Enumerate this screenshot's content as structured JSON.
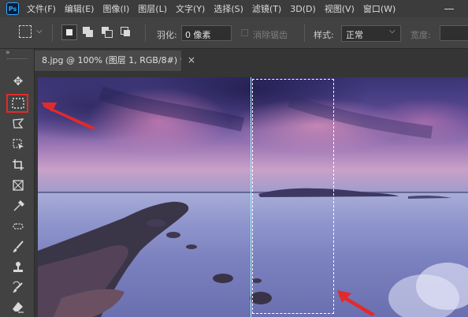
{
  "app": {
    "logo": "Ps"
  },
  "menu": [
    "文件(F)",
    "编辑(E)",
    "图像(I)",
    "图层(L)",
    "文字(Y)",
    "选择(S)",
    "滤镜(T)",
    "3D(D)",
    "视图(V)",
    "窗口(W)"
  ],
  "options_bar": {
    "feather_label": "羽化:",
    "feather_value": "0 像素",
    "antialias_label": "消除锯齿",
    "style_label": "样式:",
    "style_value": "正常",
    "width_label": "宽度:"
  },
  "document": {
    "tab_title": "8.jpg @ 100% (图层 1, RGB/8#) *",
    "close_glyph": "×"
  },
  "tools": [
    {
      "name": "move-tool",
      "glyph": "✥"
    },
    {
      "name": "rectangular-marquee-tool",
      "glyph": "⬚"
    },
    {
      "name": "lasso-tool",
      "glyph": "ʘ"
    },
    {
      "name": "object-selection-tool",
      "glyph": "▣"
    },
    {
      "name": "crop-tool",
      "glyph": "⌗"
    },
    {
      "name": "frame-tool",
      "glyph": "⊠"
    },
    {
      "name": "eyedropper-tool",
      "glyph": "✎"
    },
    {
      "name": "spot-healing-tool",
      "glyph": "✱"
    },
    {
      "name": "brush-tool",
      "glyph": "✏"
    },
    {
      "name": "clone-stamp-tool",
      "glyph": "♜"
    },
    {
      "name": "history-brush-tool",
      "glyph": "↺"
    },
    {
      "name": "eraser-tool",
      "glyph": "◢"
    }
  ],
  "colors": {
    "highlight": "#e32a2a",
    "arrow": "#e32a2a",
    "selection_guide": "#9ff2ff"
  }
}
